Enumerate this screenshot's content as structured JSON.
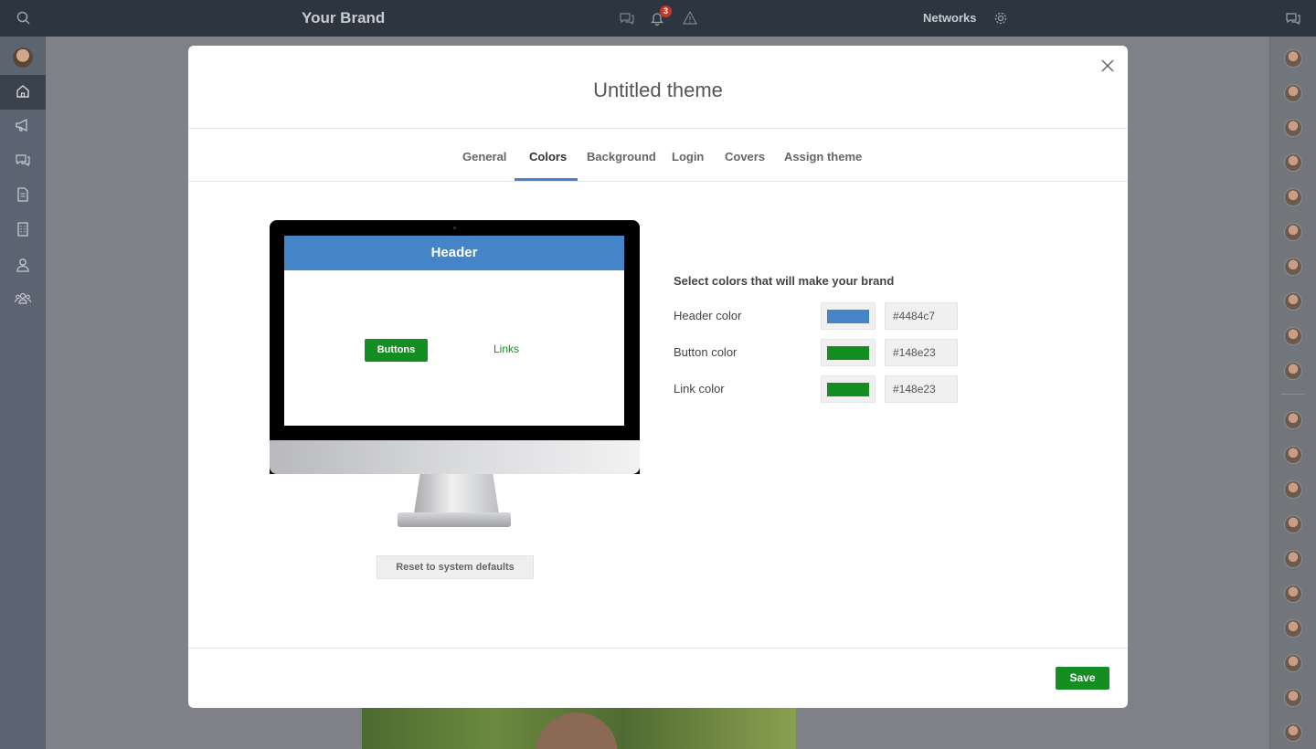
{
  "topbar": {
    "brand": "Your Brand",
    "notification_count": "3",
    "networks_label": "Networks",
    "icons": [
      "search-icon",
      "chat-bubbles-icon",
      "bell-icon",
      "warning-icon",
      "gear-icon",
      "messages-icon"
    ]
  },
  "sidebar": {
    "items": [
      "home-icon",
      "megaphone-icon",
      "chat-icon",
      "document-icon",
      "building-icon",
      "person-icon",
      "people-icon"
    ]
  },
  "modal": {
    "title": "Untitled theme",
    "tabs": [
      "General",
      "Colors",
      "Background",
      "Login",
      "Covers",
      "Assign theme"
    ],
    "active_tab": "Colors",
    "preview": {
      "header_text": "Header",
      "button_text": "Buttons",
      "link_text": "Links"
    },
    "reset_label": "Reset to system defaults",
    "colors_title": "Select colors that will make your brand",
    "rows": [
      {
        "label": "Header color",
        "value": "#4484c7"
      },
      {
        "label": "Button color",
        "value": "#148e23"
      },
      {
        "label": "Link color",
        "value": "#148e23"
      }
    ],
    "save_label": "Save"
  },
  "colors": {
    "header": "#4484c7",
    "button": "#148e23",
    "link": "#148e23"
  }
}
